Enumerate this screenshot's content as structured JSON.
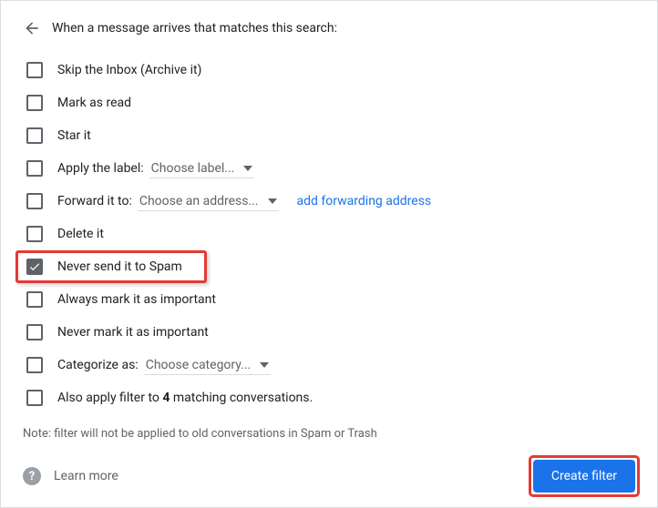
{
  "header": {
    "title": "When a message arrives that matches this search:"
  },
  "options": {
    "skip_inbox": {
      "label": "Skip the Inbox (Archive it)",
      "checked": false
    },
    "mark_read": {
      "label": "Mark as read",
      "checked": false
    },
    "star": {
      "label": "Star it",
      "checked": false
    },
    "apply_label": {
      "label": "Apply the label:",
      "dropdown": "Choose label...",
      "checked": false
    },
    "forward": {
      "label": "Forward it to:",
      "dropdown": "Choose an address...",
      "link": "add forwarding address",
      "checked": false
    },
    "delete": {
      "label": "Delete it",
      "checked": false
    },
    "never_spam": {
      "label": "Never send it to Spam",
      "checked": true
    },
    "mark_important": {
      "label": "Always mark it as important",
      "checked": false
    },
    "never_important": {
      "label": "Never mark it as important",
      "checked": false
    },
    "categorize": {
      "label": "Categorize as:",
      "dropdown": "Choose category...",
      "checked": false
    },
    "also_apply_prefix": "Also apply filter to ",
    "also_apply_count": "4",
    "also_apply_suffix": " matching conversations."
  },
  "note": "Note: filter will not be applied to old conversations in Spam or Trash",
  "footer": {
    "learn_more": "Learn more",
    "create_button": "Create filter"
  }
}
